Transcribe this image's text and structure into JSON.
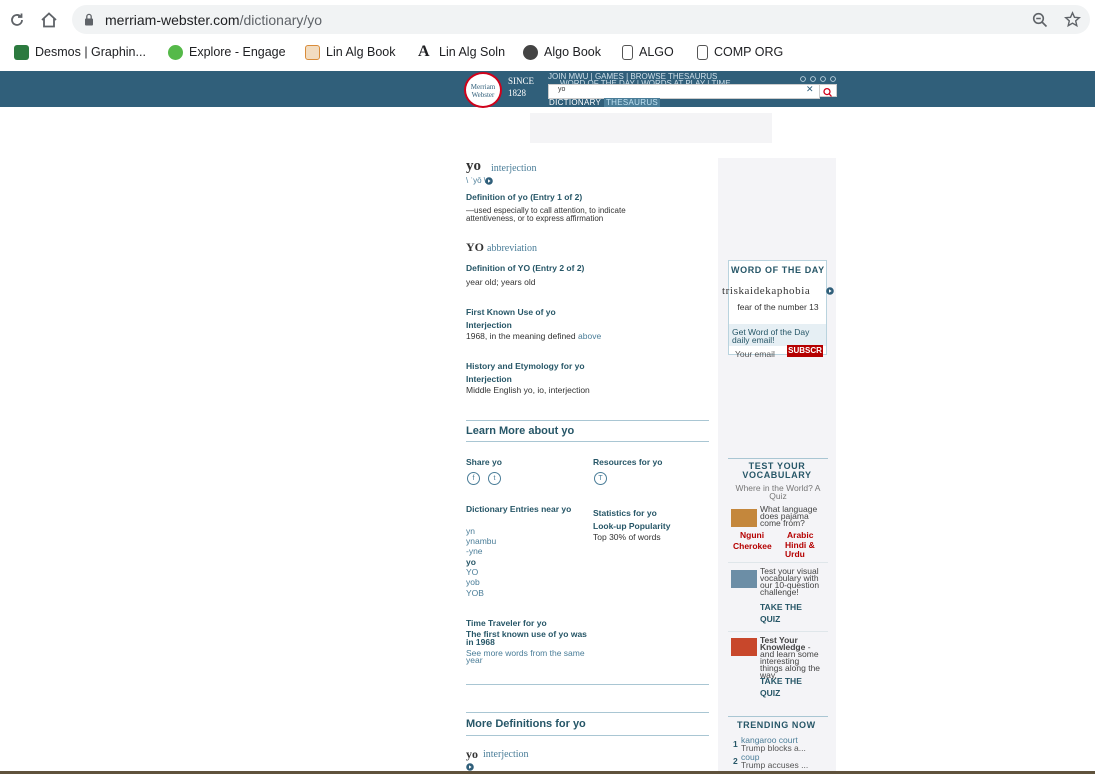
{
  "browser": {
    "url_host": "merriam-webster.com",
    "url_path": "/dictionary/yo",
    "bookmarks": [
      {
        "label": "Desmos | Graphin...",
        "icon": "desmos-icon",
        "color": "#2c7a3f"
      },
      {
        "label": "Explore - Engage",
        "icon": "engage-icon",
        "color": "#55b949"
      },
      {
        "label": "Lin Alg Book",
        "icon": "book-icon",
        "color": "#d98c3a"
      },
      {
        "label": "Lin Alg Soln",
        "icon": "letter-a-icon",
        "color": "#222222"
      },
      {
        "label": "Algo Book",
        "icon": "globe-icon",
        "color": "#444444"
      },
      {
        "label": "ALGO",
        "icon": "building-icon",
        "color": "#555555"
      },
      {
        "label": "COMP ORG",
        "icon": "building-icon",
        "color": "#555555"
      }
    ]
  },
  "header": {
    "logo_text": "Merriam Webster",
    "since": "SINCE",
    "year": "1828",
    "nav_row1": "JOIN MWU  |  GAMES  |  BROWSE THESAURUS",
    "nav_row2": "WORD OF THE DAY  |  WORDS AT PLAY  |  TIME",
    "search_value": "yo",
    "tab_dictionary": "DICTIONARY",
    "tab_thesaurus": "THESAURUS"
  },
  "entry1": {
    "headword": "yo",
    "pos": "interjection",
    "pron": "\\ ˈyō \\",
    "def_title": "Definition of yo (Entry 1 of 2)",
    "def_text": "—used especially to call attention, to indicate attentiveness, or to express affirmation"
  },
  "entry2": {
    "headword": "YO",
    "pos": "abbreviation",
    "def_title": "Definition of YO (Entry 2 of 2)",
    "def_text": "year old; years old"
  },
  "first_use": {
    "title": "First Known Use of yo",
    "pos": "Interjection",
    "text": "1968, in the meaning defined ",
    "link": "above"
  },
  "etymology": {
    "title": "History and Etymology for yo",
    "pos": "Interjection",
    "text": "Middle English yo, io, interjection"
  },
  "learn_more": {
    "title": "Learn More about yo",
    "share": "Share yo",
    "resources": "Resources for yo",
    "nearby_title": "Dictionary Entries near yo",
    "nearby": [
      "yn",
      "ynambu",
      "-yne",
      "yo",
      "YO",
      "yob",
      "YOB"
    ],
    "stats_title": "Statistics for yo",
    "stats_sub": "Look-up Popularity",
    "stats_text": "Top 30% of words",
    "tt_title": "Time Traveler for yo",
    "tt_text": "The first known use of yo was in 1968",
    "tt_link": "See more words from the same year"
  },
  "more_defs": {
    "title": "More Definitions for yo",
    "headword": "yo",
    "pos": "interjection"
  },
  "sidebar": {
    "wod_title": "WORD OF THE DAY",
    "wod_word": "triskaidekaphobia",
    "wod_def": "fear of the number 13",
    "wod_cta": "Get Word of the Day daily email!",
    "email_placeholder": "Your email",
    "subscribe": "SUBSCR",
    "vocab_title": "TEST YOUR VOCABULARY",
    "quiz_prompt": "Where in the World? A Quiz",
    "quiz_q": "What language does pajama come from?",
    "quiz_opts": [
      "Nguni",
      "Arabic",
      "Cherokee",
      "Hindi & Urdu"
    ],
    "quiz2_text": "Test your visual vocabulary with our 10-question challenge!",
    "quiz2_cta": "TAKE THE QUIZ",
    "quiz3_title": "Test Your Knowledge",
    "quiz3_text": "- and learn some interesting things along the way.",
    "quiz3_cta": "TAKE THE QUIZ",
    "trending_title": "TRENDING NOW",
    "trending": [
      {
        "num": "1",
        "term": "kangaroo court",
        "note": "Trump blocks a..."
      },
      {
        "num": "2",
        "term": "coup",
        "note": "Trump accuses ..."
      }
    ]
  }
}
